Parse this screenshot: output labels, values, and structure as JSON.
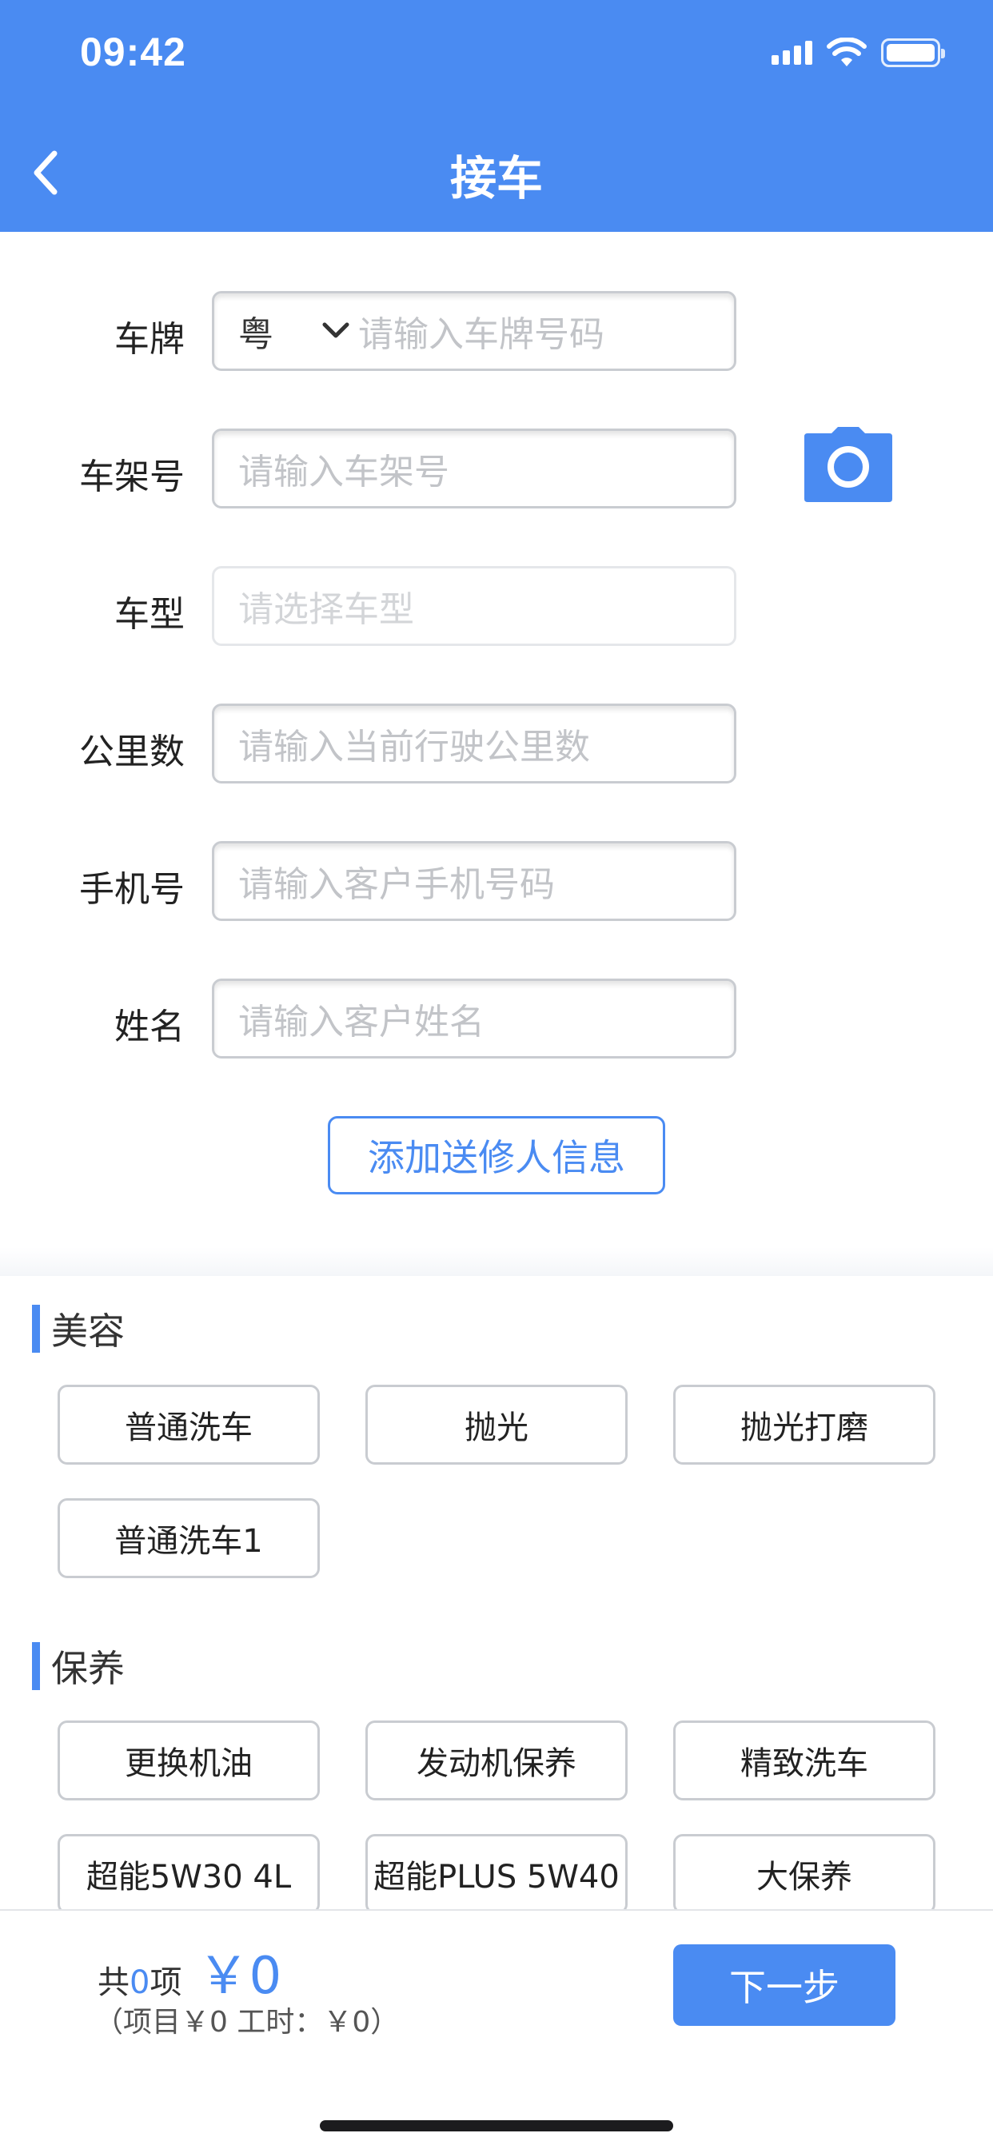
{
  "status_bar": {
    "time": "09:42"
  },
  "nav": {
    "title": "接车"
  },
  "form": {
    "plate": {
      "label": "车牌",
      "prefix": "粤",
      "placeholder": "请输入车牌号码"
    },
    "vin": {
      "label": "车架号",
      "placeholder": "请输入车架号"
    },
    "model": {
      "label": "车型",
      "placeholder": "请选择车型"
    },
    "mileage": {
      "label": "公里数",
      "placeholder": "请输入当前行驶公里数"
    },
    "phone": {
      "label": "手机号",
      "placeholder": "请输入客户手机号码"
    },
    "name": {
      "label": "姓名",
      "placeholder": "请输入客户姓名"
    },
    "add_sender_label": "添加送修人信息"
  },
  "sections": [
    {
      "title": "美容",
      "items": [
        "普通洗车",
        "抛光",
        "抛光打磨",
        "普通洗车1"
      ]
    },
    {
      "title": "保养",
      "items": [
        "更换机油",
        "发动机保养",
        "精致洗车",
        "超能5W30 4L",
        "超能PLUS 5W40",
        "大保养"
      ]
    }
  ],
  "footer": {
    "total_prefix": "共",
    "count": "0",
    "total_suffix": "项",
    "amount": "￥0",
    "breakdown": "（项目￥0 工时：￥0）",
    "next_label": "下一步"
  },
  "colors": {
    "primary": "#4a8bf2",
    "border": "#c9ccd1"
  }
}
